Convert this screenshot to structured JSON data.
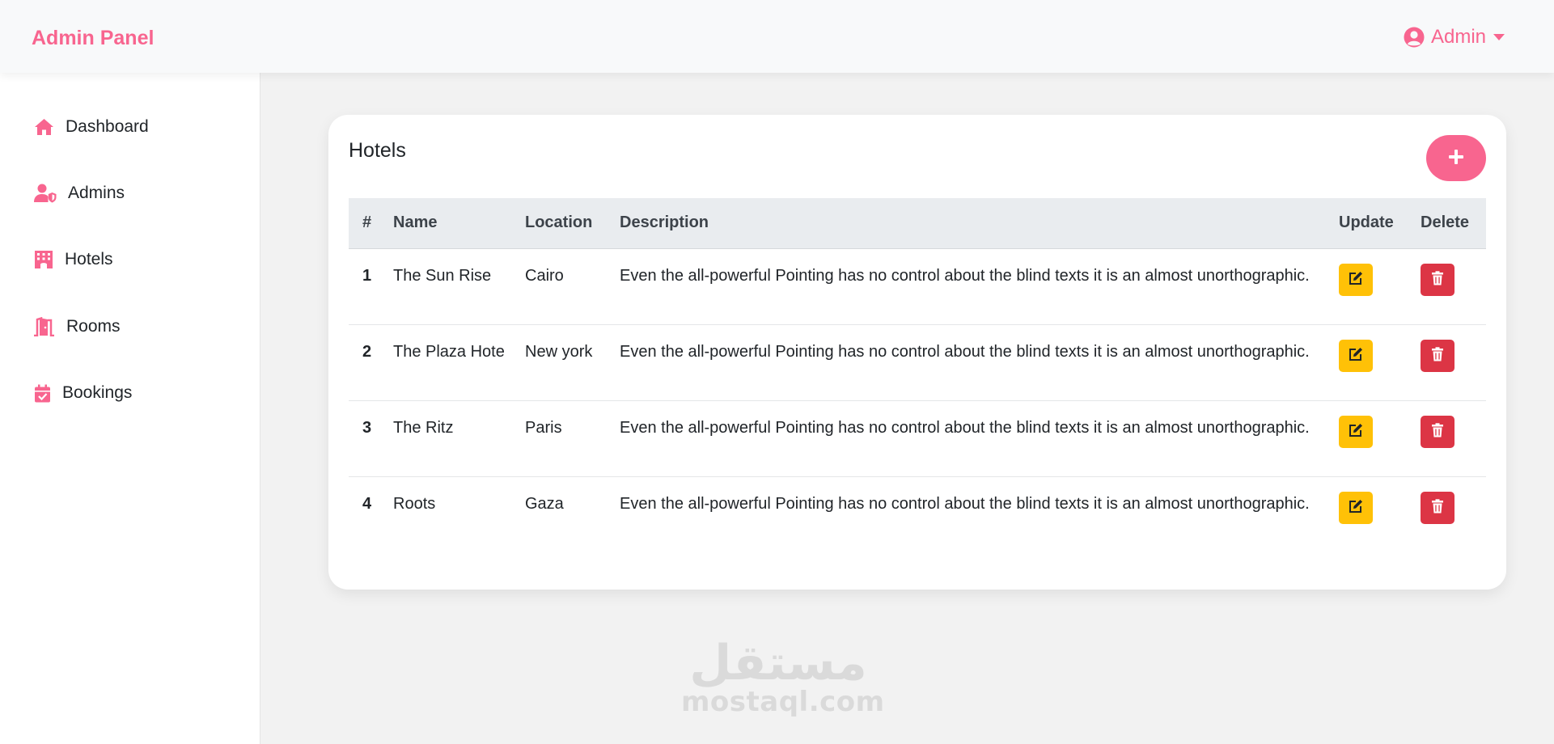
{
  "app": {
    "brand": "Admin Panel",
    "user_label": "Admin"
  },
  "colors": {
    "accent": "#f8658f",
    "update": "#ffc107",
    "delete": "#dc3545"
  },
  "sidebar": {
    "items": [
      {
        "label": "Dashboard",
        "icon": "home-icon"
      },
      {
        "label": "Admins",
        "icon": "user-shield-icon"
      },
      {
        "label": "Hotels",
        "icon": "hotel-icon"
      },
      {
        "label": "Rooms",
        "icon": "door-open-icon"
      },
      {
        "label": "Bookings",
        "icon": "calendar-check-icon"
      }
    ]
  },
  "main": {
    "title": "Hotels",
    "add_icon": "plus-icon",
    "table": {
      "columns": [
        "#",
        "Name",
        "Location",
        "Description",
        "Update",
        "Delete"
      ],
      "rows": [
        {
          "num": "1",
          "name": "The Sun Rise",
          "location": "Cairo",
          "description": "Even the all-powerful Pointing has no control about the blind texts it is an almost unorthographic."
        },
        {
          "num": "2",
          "name": "The Plaza Hote",
          "location": "New york",
          "description": "Even the all-powerful Pointing has no control about the blind texts it is an almost unorthographic."
        },
        {
          "num": "3",
          "name": "The Ritz",
          "location": "Paris",
          "description": "Even the all-powerful Pointing has no control about the blind texts it is an almost unorthographic."
        },
        {
          "num": "4",
          "name": "Roots",
          "location": "Gaza",
          "description": "Even the all-powerful Pointing has no control about the blind texts it is an almost unorthographic."
        }
      ],
      "update_icon": "edit-icon",
      "delete_icon": "trash-icon"
    }
  },
  "watermark": {
    "arabic": "مستقل",
    "latin": "mostaql.com"
  }
}
